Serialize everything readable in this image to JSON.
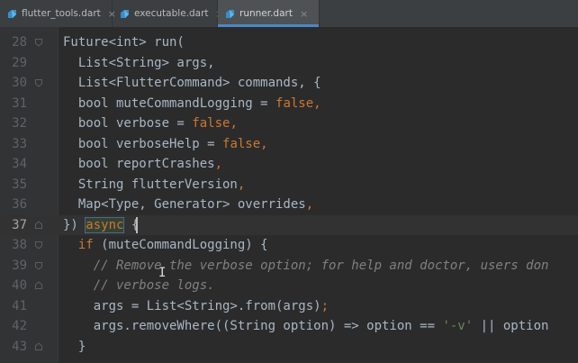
{
  "tabs": [
    {
      "label": "flutter_tools.dart",
      "icon": "dart-file-icon",
      "active": false
    },
    {
      "label": "executable.dart",
      "icon": "dart-file-icon",
      "active": false
    },
    {
      "label": "runner.dart",
      "icon": "dart-file-icon",
      "active": true
    }
  ],
  "tab_close": "×",
  "colors": {
    "keyword": "#cc7832",
    "identifier": "#a9b7c6",
    "comment": "#808080",
    "string": "#6a8759",
    "background": "#2b2b2b",
    "gutter": "#313335",
    "tab_accent": "#4a88c7"
  },
  "editor": {
    "current_line": "37",
    "lines": [
      {
        "num": "28",
        "segments": [
          {
            "t": "Future<int> run(",
            "c": "tp"
          }
        ]
      },
      {
        "num": "29",
        "segments": [
          {
            "t": "  List<String> args,",
            "c": "tp"
          }
        ]
      },
      {
        "num": "30",
        "segments": [
          {
            "t": "  List<FlutterCommand> commands, {",
            "c": "tp"
          }
        ]
      },
      {
        "num": "31",
        "segments": [
          {
            "t": "  bool muteCommandLogging = ",
            "c": "tp"
          },
          {
            "t": "false",
            "c": "kw"
          },
          {
            "t": ",",
            "c": "kw"
          }
        ]
      },
      {
        "num": "32",
        "segments": [
          {
            "t": "  bool verbose = ",
            "c": "tp"
          },
          {
            "t": "false",
            "c": "kw"
          },
          {
            "t": ",",
            "c": "kw"
          }
        ]
      },
      {
        "num": "33",
        "segments": [
          {
            "t": "  bool verboseHelp = ",
            "c": "tp"
          },
          {
            "t": "false",
            "c": "kw"
          },
          {
            "t": ",",
            "c": "kw"
          }
        ]
      },
      {
        "num": "34",
        "segments": [
          {
            "t": "  bool reportCrashes",
            "c": "tp"
          },
          {
            "t": ",",
            "c": "kw"
          }
        ]
      },
      {
        "num": "35",
        "segments": [
          {
            "t": "  String flutterVersion",
            "c": "tp"
          },
          {
            "t": ",",
            "c": "kw"
          }
        ]
      },
      {
        "num": "36",
        "segments": [
          {
            "t": "  Map<Type, Generator> overrides",
            "c": "tp"
          },
          {
            "t": ",",
            "c": "kw"
          }
        ]
      },
      {
        "num": "37",
        "segments": [
          {
            "t": "}) ",
            "c": "tp"
          },
          {
            "t": "async",
            "c": "asyncHl"
          },
          {
            "t": " {",
            "c": "tp"
          }
        ]
      },
      {
        "num": "38",
        "segments": [
          {
            "t": "  ",
            "c": "tp"
          },
          {
            "t": "if",
            "c": "kw"
          },
          {
            "t": " (muteCommandLogging) {",
            "c": "tp"
          }
        ]
      },
      {
        "num": "39",
        "segments": [
          {
            "t": "    // Remove the verbose option; for help and doctor, users don",
            "c": "cm"
          }
        ]
      },
      {
        "num": "40",
        "segments": [
          {
            "t": "    // verbose logs.",
            "c": "cm"
          }
        ]
      },
      {
        "num": "41",
        "segments": [
          {
            "t": "    args = List<String>.from(args)",
            "c": "tp"
          },
          {
            "t": ";",
            "c": "kw"
          }
        ]
      },
      {
        "num": "42",
        "segments": [
          {
            "t": "    args.removeWhere((String option) => option == ",
            "c": "tp"
          },
          {
            "t": "'-v'",
            "c": "str"
          },
          {
            "t": " || option",
            "c": "tp"
          }
        ]
      },
      {
        "num": "43",
        "segments": [
          {
            "t": "  }",
            "c": "tp"
          }
        ]
      }
    ]
  },
  "fold_markers": {
    "28": "fold-open-icon",
    "30": "fold-open-icon",
    "37": "fold-close-icon",
    "38": "fold-open-icon",
    "39": "fold-open-icon",
    "40": "fold-close-icon",
    "43": "fold-close-icon"
  }
}
